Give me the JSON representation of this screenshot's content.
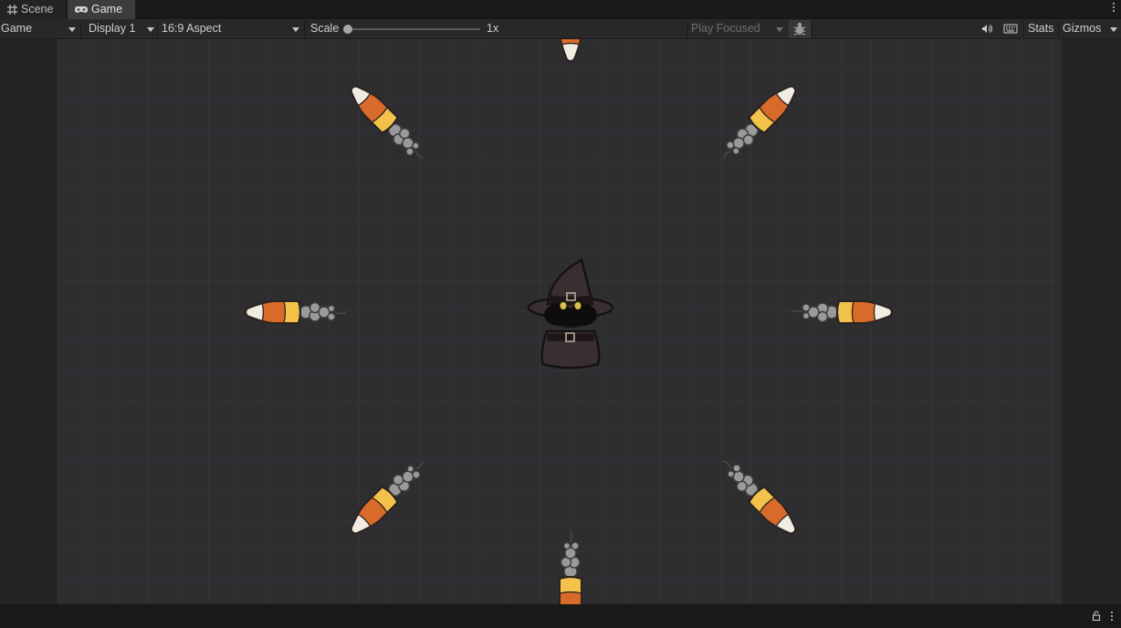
{
  "tabs": [
    {
      "label": "Scene",
      "icon": "grid-icon",
      "active": false
    },
    {
      "label": "Game",
      "icon": "gamepad-icon",
      "active": true
    }
  ],
  "toolbar": {
    "view_mode": "Game",
    "display": "Display 1",
    "aspect": "16:9 Aspect",
    "scale_label": "Scale",
    "scale_value": "1x",
    "play_mode": "Play Focused",
    "stats_label": "Stats",
    "gizmos_label": "Gizmos",
    "icons": [
      "bug-icon",
      "speaker-icon",
      "keyboard-icon"
    ]
  },
  "scene": {
    "player": "witch",
    "projectiles": [
      "candy-corn"
    ],
    "projectile_count": 8
  },
  "statusbar": {
    "icons": [
      "lock-icon",
      "kebab-icon"
    ]
  },
  "colors": {
    "background": "#191919",
    "toolbar": "#282828",
    "game_view": "#2e2e31",
    "active_tab": "#3c3c3c",
    "candy_white": "#f1ece2",
    "candy_orange": "#d86a2a",
    "candy_yellow": "#f2c24a",
    "witch_robe": "#3a2f30"
  }
}
